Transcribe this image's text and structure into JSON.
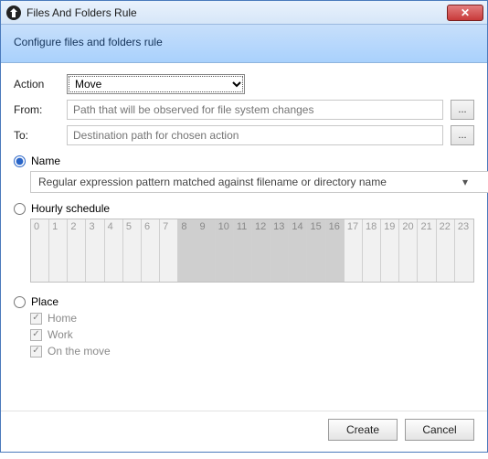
{
  "window": {
    "title": "Files And Folders Rule"
  },
  "header": {
    "text": "Configure files and folders rule"
  },
  "form": {
    "action_label": "Action",
    "action_value": "Move",
    "from_label": "From:",
    "from_placeholder": "Path that will be observed for file system changes",
    "to_label": "To:",
    "to_placeholder": "Destination path for chosen action",
    "browse_label": "..."
  },
  "filters": {
    "name_label": "Name",
    "name_pattern_placeholder": "Regular expression pattern matched against filename or directory name",
    "hourly_label": "Hourly schedule",
    "hours": [
      "0",
      "1",
      "2",
      "3",
      "4",
      "5",
      "6",
      "7",
      "8",
      "9",
      "10",
      "11",
      "12",
      "13",
      "14",
      "15",
      "16",
      "17",
      "18",
      "19",
      "20",
      "21",
      "22",
      "23"
    ],
    "shaded_from": 8,
    "shaded_to": 16,
    "place_label": "Place",
    "places": [
      "Home",
      "Work",
      "On the move"
    ]
  },
  "footer": {
    "create": "Create",
    "cancel": "Cancel"
  }
}
